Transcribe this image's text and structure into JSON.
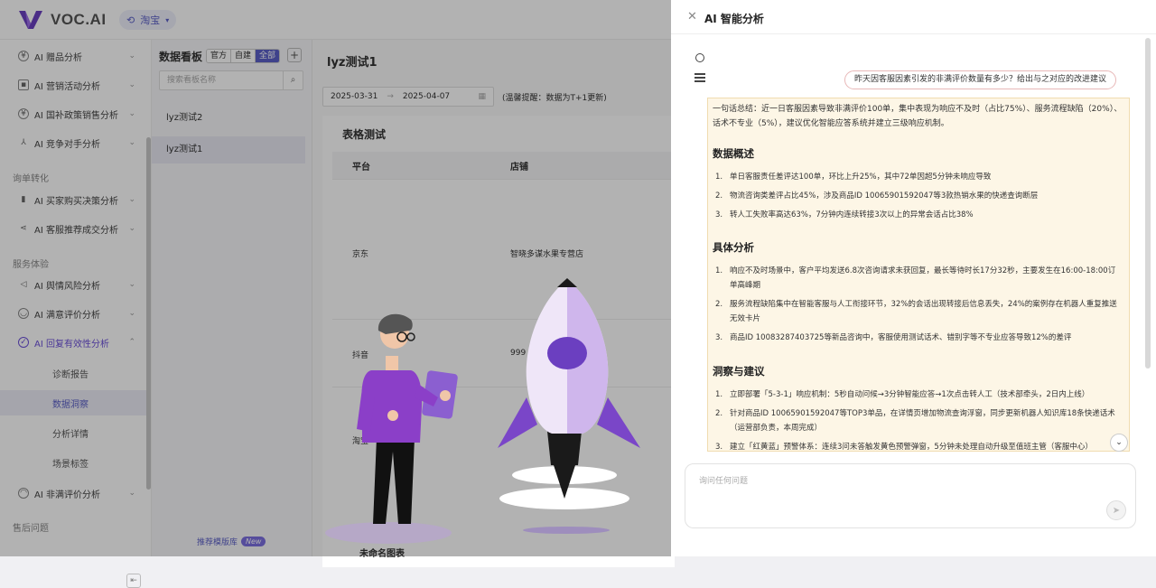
{
  "header": {
    "logo_text": "VOC.AI",
    "platform": "淘宝"
  },
  "sidebar": {
    "items": [
      {
        "label": "AI 赠品分析",
        "icon": "gift-icon"
      },
      {
        "label": "AI 营销活动分析",
        "icon": "campaign-icon"
      },
      {
        "label": "AI 国补政策销售分析",
        "icon": "shield-icon"
      },
      {
        "label": "AI 竞争对手分析",
        "icon": "competitor-icon"
      }
    ],
    "section_inquiry": "询单转化",
    "items2": [
      {
        "label": "AI 买家购买决策分析",
        "icon": "chart-icon"
      },
      {
        "label": "AI 客服推荐成交分析",
        "icon": "share-icon"
      }
    ],
    "section_service": "服务体验",
    "items3": [
      {
        "label": "AI 舆情风险分析",
        "icon": "speaker-icon"
      },
      {
        "label": "AI 满意评价分析",
        "icon": "smile-icon"
      },
      {
        "label": "AI 回复有效性分析",
        "icon": "reply-icon"
      }
    ],
    "subitems": [
      "诊断报告",
      "数据洞察",
      "分析详情",
      "场景标签"
    ],
    "items4": [
      {
        "label": "AI 非满评价分析",
        "icon": "frown-icon"
      }
    ],
    "section_after": "售后问题"
  },
  "dashboard": {
    "title": "数据看板",
    "filters": [
      "官方",
      "自建",
      "全部"
    ],
    "search_placeholder": "搜索看板名称",
    "items": [
      "lyz测试2",
      "lyz测试1"
    ],
    "footer_link": "推荐模版库",
    "footer_badge": "New"
  },
  "main": {
    "title": "lyz测试1",
    "date_start": "2025-03-31",
    "date_arrow": "→",
    "date_end": "2025-04-07",
    "tip": "(温馨提醒：数据为T+1更新)",
    "card_title": "表格测试",
    "columns": [
      "平台",
      "店铺"
    ],
    "rows": [
      {
        "platform": "京东",
        "shop": "智晓多谋水果专营店"
      },
      {
        "platform": "抖音",
        "shop": "999"
      },
      {
        "platform": "淘宝",
        "shop": ""
      }
    ],
    "bottom_text": "未命名图表"
  },
  "drawer": {
    "title": "AI 智能分析",
    "question": "昨天因客服因素引发的非满评价数量有多少？给出与之对应的改进建议",
    "summary": "一句话总结：近一日客服因素导致非满评价100单，集中表现为响应不及时（占比75%）、服务流程缺陷（20%）、话术不专业（5%），建议优化智能应答系统并建立三级响应机制。",
    "sections": [
      {
        "title": "数据概述",
        "items": [
          "单日客服责任差评达100单，环比上升25%，其中72单因超5分钟未响应导致",
          "物流咨询类差评占比45%，涉及商品ID 10065901592047等3款热销水果的快递查询断层",
          "转人工失败率高达63%，7分钟内连续转接3次以上的异常会话占比38%"
        ]
      },
      {
        "title": "具体分析",
        "items": [
          "响应不及时场景中，客户平均发送6.8次咨询请求未获回复，最长等待时长17分32秒，主要发生在16:00-18:00订单高峰期",
          "服务流程缺陷集中在智能客服与人工衔接环节，32%的会话出现转接后信息丢失，24%的案例存在机器人重复推送无效卡片",
          "商品ID 10083287403725等新品咨询中，客服使用测试话术、错别字等不专业应答导致12%的差评"
        ]
      },
      {
        "title": "洞察与建议",
        "items": [
          "立即部署「5-3-1」响应机制：5秒自动问候→3分钟智能应答→1次点击转人工（技术部牵头，2日内上线）",
          "针对商品ID 10065901592047等TOP3单品，在详情页增加物流查询浮窗，同步更新机器人知识库18条快递话术（运营部负责，本周完成）",
          "建立「红黄蓝」预警体系：连续3问未答触发黄色预警弹窗，5分钟未处理自动升级至值班主管（客服中心）"
        ]
      }
    ],
    "input_placeholder": "询问任何问题"
  }
}
